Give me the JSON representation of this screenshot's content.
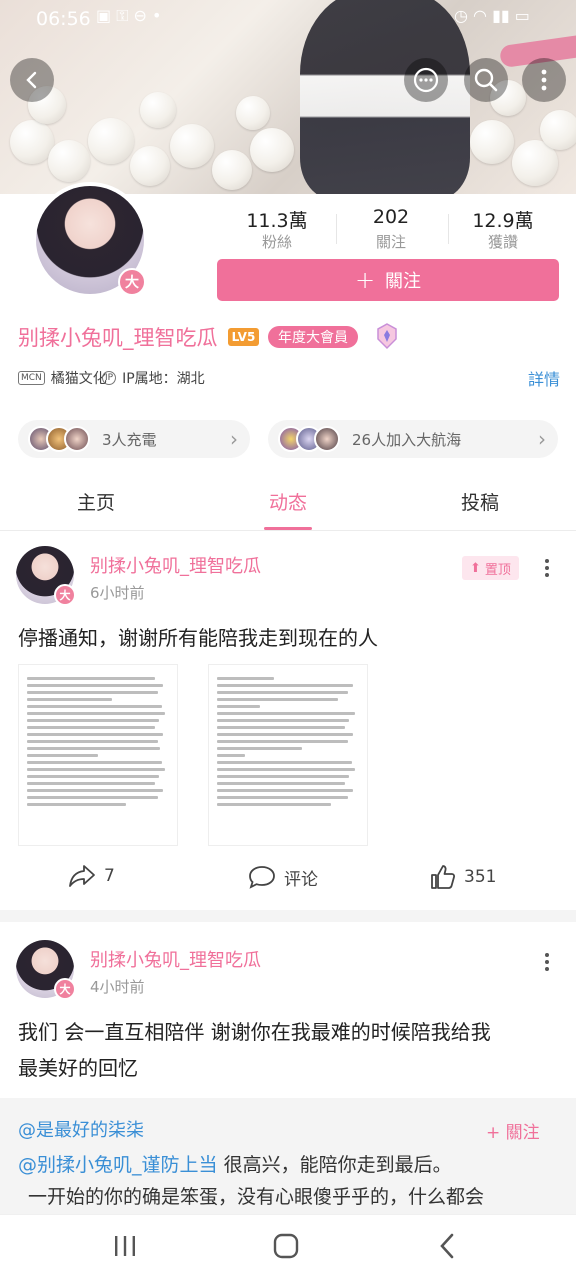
{
  "status_bar": {
    "time": "06:56"
  },
  "profile": {
    "stats": [
      {
        "value": "11.3萬",
        "label": "粉絲"
      },
      {
        "value": "202",
        "label": "關注"
      },
      {
        "value": "12.9萬",
        "label": "獲讚"
      }
    ],
    "follow_label": "關注",
    "follow_plus": "+",
    "name": "别揉小兔叽_理智吃瓜",
    "level": "LV5",
    "vip_label": "年度大會員",
    "avatar_badge": "大",
    "org_tag": "MCN",
    "org_name": "橘猫文化",
    "ip_tag": "IP",
    "ip_text": "IP属地：湖北",
    "detail_label": "詳情",
    "charge_text": "3人充電",
    "fleet_text": "26人加入大航海"
  },
  "tabs": [
    {
      "label": "主页"
    },
    {
      "label": "动态"
    },
    {
      "label": "投稿"
    }
  ],
  "posts": [
    {
      "author": "别揉小兔叽_理智吃瓜",
      "time": "6小时前",
      "pin_label": "置顶",
      "text": "停播通知，谢谢所有能陪我走到现在的人",
      "shares": "7",
      "comment_label": "评论",
      "likes": "351"
    },
    {
      "author": "别揉小兔叽_理智吃瓜",
      "time": "4小时前",
      "text_line1": "我们 会一直互相陪伴 谢谢你在我最难的时候陪我给我",
      "text_line2": "最美好的回忆"
    }
  ],
  "repost": {
    "author": "@是最好的柒柒",
    "follow_label": "+ 關注",
    "mention": "@别揉小兔叽_谨防上当",
    "line1": "很高兴，能陪你走到最后。",
    "line2": "一开始的你的确是笨蛋，没有心眼傻乎乎的，什么都会"
  },
  "colors": {
    "accent": "#f0709a",
    "link": "#3a8fd6"
  }
}
